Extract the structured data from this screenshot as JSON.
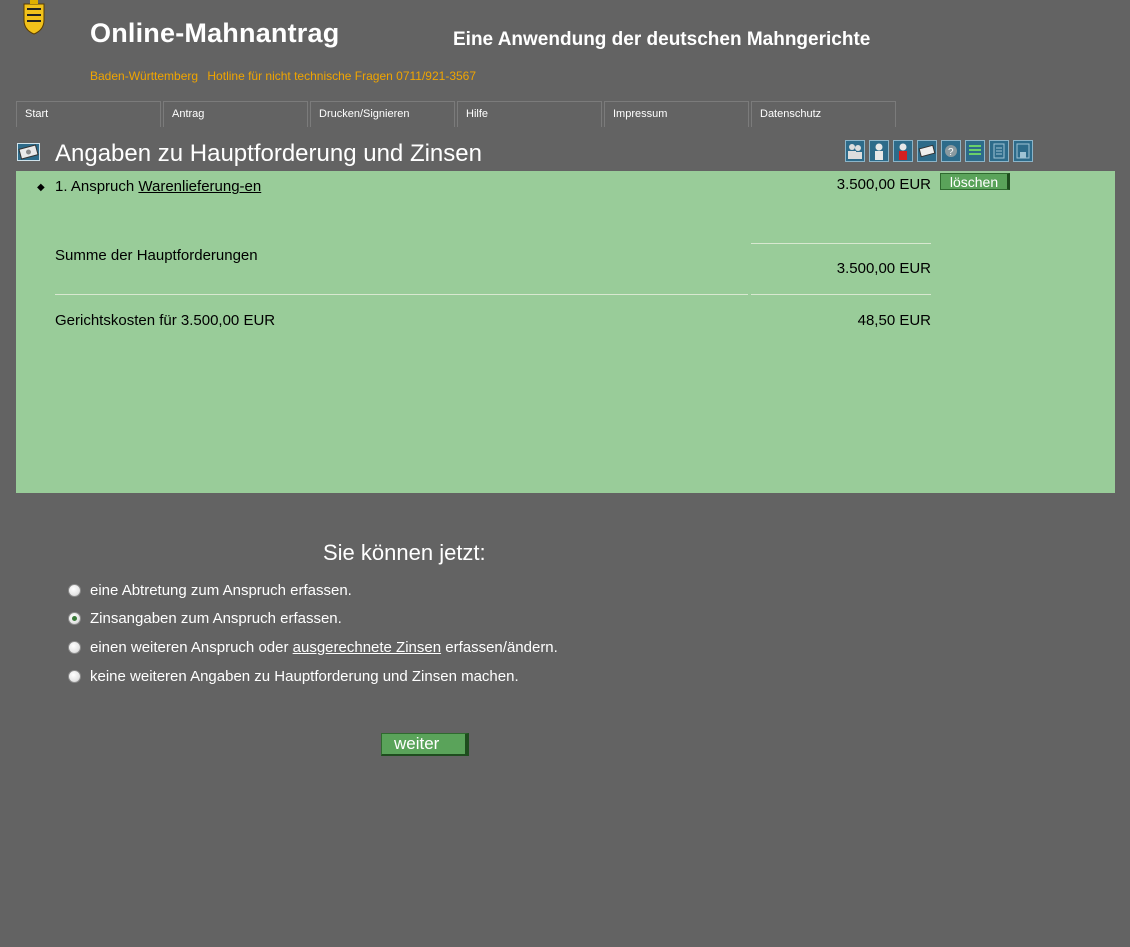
{
  "header": {
    "title": "Online-Mahnantrag",
    "subtitle": "Eine Anwendung der deutschen Mahngerichte",
    "state": "Baden-Württemberg",
    "hotline": "Hotline für nicht technische Fragen 0711/921-3567",
    "logo_icon": "coat-of-arms-icon"
  },
  "nav": {
    "items": [
      {
        "label": "Start"
      },
      {
        "label": "Antrag"
      },
      {
        "label": "Drucken/Signieren"
      },
      {
        "label": "Hilfe"
      },
      {
        "label": "Impressum"
      },
      {
        "label": "Datenschutz"
      }
    ]
  },
  "section": {
    "icon": "money-icon",
    "title": "Angaben zu Hauptforderung und Zinsen",
    "toolbar_icons": [
      "parties-icon",
      "person-icon",
      "person-red-icon",
      "money-icon",
      "question-icon",
      "list-icon",
      "document-icon",
      "save-icon"
    ]
  },
  "claims": {
    "items": [
      {
        "number_prefix": "1. Anspruch",
        "type": "Warenlieferung-en",
        "amount": "3.500,00 EUR",
        "delete_label": "löschen"
      }
    ],
    "sum_label": "Summe der Hauptforderungen",
    "sum_value": "3.500,00 EUR",
    "court_costs_label": "Gerichtskosten für 3.500,00 EUR",
    "court_costs_value": "48,50 EUR"
  },
  "options": {
    "title": "Sie können jetzt:",
    "items": [
      {
        "text": "eine Abtretung zum Anspruch erfassen.",
        "checked": false
      },
      {
        "text": "Zinsangaben zum Anspruch erfassen.",
        "checked": true
      },
      {
        "text_before": "einen weiteren Anspruch oder ",
        "link": "ausgerechnete Zinsen",
        "text_after": " erfassen/ändern.",
        "checked": false
      },
      {
        "text": "keine weiteren Angaben zu Hauptforderung und Zinsen machen.",
        "checked": false
      }
    ],
    "next_label": "weiter"
  },
  "colors": {
    "background": "#636363",
    "panel": "#99cc99",
    "accent_orange": "#f0a500",
    "button_green": "#5aa35a"
  }
}
